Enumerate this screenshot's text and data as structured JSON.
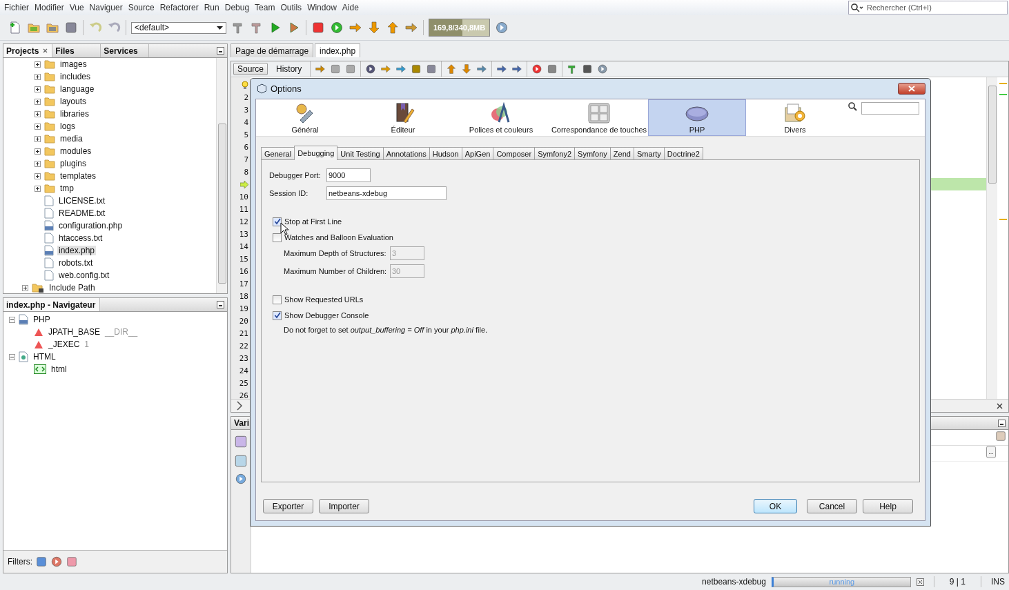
{
  "menu": [
    "Fichier",
    "Modifier",
    "Vue",
    "Naviguer",
    "Source",
    "Refactorer",
    "Run",
    "Debug",
    "Team",
    "Outils",
    "Window",
    "Aide"
  ],
  "search": {
    "placeholder": "Rechercher (Ctrl+I)"
  },
  "toolbar": {
    "configuration": "<default>",
    "memory": "169,8/340,8MB"
  },
  "projects_panel": {
    "tabs": [
      {
        "label": "Projects",
        "selected": true
      },
      {
        "label": "Files",
        "selected": false
      },
      {
        "label": "Services",
        "selected": false
      }
    ],
    "tree": [
      {
        "kind": "scrolled",
        "children": [
          {
            "label": "images",
            "kind": "folder",
            "selected": false
          },
          {
            "label": "includes",
            "kind": "folder",
            "selected": false
          },
          {
            "label": "language",
            "kind": "folder",
            "selected": false
          },
          {
            "label": "layouts",
            "kind": "folder",
            "selected": false
          },
          {
            "label": "libraries",
            "kind": "folder",
            "selected": false
          },
          {
            "label": "logs",
            "kind": "folder",
            "selected": false
          },
          {
            "label": "media",
            "kind": "folder",
            "selected": false
          },
          {
            "label": "modules",
            "kind": "folder",
            "selected": false
          },
          {
            "label": "plugins",
            "kind": "folder",
            "selected": false
          },
          {
            "label": "templates",
            "kind": "folder",
            "selected": false
          },
          {
            "label": "tmp",
            "kind": "folder",
            "selected": false
          },
          {
            "label": "LICENSE.txt",
            "kind": "text",
            "selected": false
          },
          {
            "label": "README.txt",
            "kind": "text",
            "selected": false
          },
          {
            "label": "configuration.php",
            "kind": "php",
            "selected": false
          },
          {
            "label": "htaccess.txt",
            "kind": "text",
            "selected": false
          },
          {
            "label": "index.php",
            "kind": "php",
            "selected": true
          },
          {
            "label": "robots.txt",
            "kind": "text",
            "selected": false
          },
          {
            "label": "web.config.txt",
            "kind": "text",
            "selected": false
          }
        ]
      },
      {
        "label": "Include Path",
        "kind": "library",
        "selected": false
      }
    ]
  },
  "navigator": {
    "title": "index.php - Navigateur",
    "tree": [
      {
        "label": "PHP",
        "kind": "php",
        "expanded": true,
        "children": [
          {
            "label": "JPATH_BASE",
            "detail": "__DIR__",
            "kind": "constant"
          },
          {
            "label": "_JEXEC",
            "detail": "1",
            "kind": "constant"
          }
        ]
      },
      {
        "label": "HTML",
        "kind": "html",
        "expanded": true,
        "children": [
          {
            "label": "html",
            "kind": "tag"
          }
        ]
      }
    ],
    "filters_label": "Filters:"
  },
  "editor": {
    "tabs": [
      {
        "label": "Page de démarrage",
        "selected": false
      },
      {
        "label": "index.php",
        "selected": true
      }
    ],
    "views": [
      {
        "label": "Source",
        "selected": true
      },
      {
        "label": "History",
        "selected": false
      }
    ],
    "gutter": [
      {
        "kind": "hint"
      },
      {
        "kind": "line",
        "number": "2"
      },
      {
        "kind": "line",
        "number": "3"
      },
      {
        "kind": "line",
        "number": "4"
      },
      {
        "kind": "line",
        "number": "5"
      },
      {
        "kind": "line",
        "number": "6"
      },
      {
        "kind": "line",
        "number": "7"
      },
      {
        "kind": "line",
        "number": "8"
      },
      {
        "kind": "current"
      },
      {
        "kind": "line",
        "number": "10"
      },
      {
        "kind": "line",
        "number": "11"
      },
      {
        "kind": "line",
        "number": "12"
      },
      {
        "kind": "line",
        "number": "13"
      },
      {
        "kind": "line",
        "number": "14"
      },
      {
        "kind": "line",
        "number": "15"
      },
      {
        "kind": "line",
        "number": "16"
      },
      {
        "kind": "line",
        "number": "17"
      },
      {
        "kind": "line",
        "number": "18"
      },
      {
        "kind": "line",
        "number": "19"
      },
      {
        "kind": "line",
        "number": "20"
      },
      {
        "kind": "line",
        "number": "21"
      },
      {
        "kind": "line",
        "number": "22"
      },
      {
        "kind": "line",
        "number": "23"
      },
      {
        "kind": "line",
        "number": "24"
      },
      {
        "kind": "line",
        "number": "25"
      },
      {
        "kind": "line",
        "number": "26"
      }
    ]
  },
  "variables_panel": {
    "tab": "Vari",
    "more_button": "..."
  },
  "status_bar": {
    "session": "netbeans-xdebug",
    "progress_bar": {
      "label": "running",
      "level": 1
    },
    "position": "9 | 1",
    "mode": "INS"
  },
  "dialog": {
    "title": "Options",
    "categories": [
      {
        "label": "Général",
        "selected": false
      },
      {
        "label": "Éditeur",
        "selected": false
      },
      {
        "label": "Polices et couleurs",
        "selected": false
      },
      {
        "label": "Correspondance de touches",
        "selected": false
      },
      {
        "label": "PHP",
        "selected": true
      },
      {
        "label": "Divers",
        "selected": false
      }
    ],
    "tabs": [
      {
        "label": "General",
        "selected": false
      },
      {
        "label": "Debugging",
        "selected": true
      },
      {
        "label": "Unit Testing",
        "selected": false
      },
      {
        "label": "Annotations",
        "selected": false
      },
      {
        "label": "Hudson",
        "selected": false
      },
      {
        "label": "ApiGen",
        "selected": false
      },
      {
        "label": "Composer",
        "selected": false
      },
      {
        "label": "Symfony2",
        "selected": false
      },
      {
        "label": "Symfony",
        "selected": false
      },
      {
        "label": "Zend",
        "selected": false
      },
      {
        "label": "Smarty",
        "selected": false
      },
      {
        "label": "Doctrine2",
        "selected": false
      }
    ],
    "settings": [
      {
        "kind": "field",
        "label": "Debugger Port:",
        "value": "9000"
      },
      {
        "kind": "field",
        "label": "Session ID:",
        "value": "netbeans-xdebug"
      },
      {
        "kind": "checkbox",
        "label": "Stop at First Line",
        "checked": true
      },
      {
        "kind": "checkbox",
        "label": "Watches and Balloon Evaluation",
        "checked": false
      },
      {
        "kind": "subfield",
        "label": "Maximum Depth of Structures:",
        "value": "3",
        "disabled": true
      },
      {
        "kind": "subfield",
        "label": "Maximum Number of Children:",
        "value": "30",
        "disabled": true
      },
      {
        "kind": "checkbox",
        "label": "Show Requested URLs",
        "checked": false
      },
      {
        "kind": "checkbox",
        "label": "Show Debugger Console",
        "checked": true
      },
      {
        "kind": "note",
        "text": "Do not forget to set *output_buffering = Off* in your *php.ini* file."
      }
    ],
    "left_buttons": [
      "Exporter",
      "Importer"
    ],
    "buttons": [
      {
        "label": "OK",
        "default": true
      },
      {
        "label": "Cancel",
        "default": false
      },
      {
        "label": "Help",
        "default": false
      }
    ]
  }
}
